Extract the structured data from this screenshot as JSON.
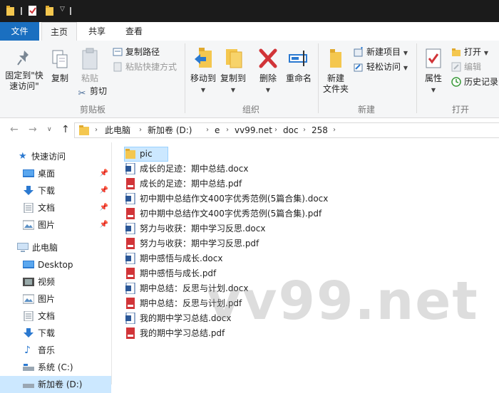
{
  "ribbon": {
    "tabs": [
      "文件",
      "主页",
      "共享",
      "查看"
    ],
    "clipboard": {
      "pin_label": "固定到\"快\n速访问\"",
      "pin_line1": "固定到\"快",
      "pin_line2": "速访问\"",
      "copy": "复制",
      "paste": "粘贴",
      "copy_path": "复制路径",
      "paste_shortcut": "粘贴快捷方式",
      "cut": "剪切",
      "group": "剪贴板"
    },
    "organize": {
      "move_to": "移动到",
      "copy_to": "复制到",
      "delete": "删除",
      "rename": "重命名",
      "group": "组织"
    },
    "new": {
      "new_folder_line1": "新建",
      "new_folder_line2": "文件夹",
      "new_item": "新建项目",
      "easy_access": "轻松访问",
      "group": "新建"
    },
    "open": {
      "properties": "属性",
      "open": "打开",
      "edit": "编辑",
      "history": "历史记录",
      "group": "打开"
    }
  },
  "address": {
    "crumbs": [
      "此电脑",
      "新加卷 (D:)",
      "e",
      "vv99.net",
      "doc",
      "258"
    ]
  },
  "sidebar": {
    "quick_access": "快速访问",
    "quick_items": [
      "桌面",
      "下载",
      "文档",
      "图片"
    ],
    "this_pc": "此电脑",
    "pc_items": [
      "Desktop",
      "视频",
      "图片",
      "文档",
      "下载",
      "音乐",
      "系统 (C:)",
      "新加卷 (D:)"
    ]
  },
  "files": [
    {
      "name": "pic",
      "type": "folder"
    },
    {
      "name": "成长的足迹：期中总结.docx",
      "type": "docx"
    },
    {
      "name": "成长的足迹：期中总结.pdf",
      "type": "pdf"
    },
    {
      "name": "初中期中总结作文400字优秀范例(5篇合集).docx",
      "type": "docx"
    },
    {
      "name": "初中期中总结作文400字优秀范例(5篇合集).pdf",
      "type": "pdf"
    },
    {
      "name": "努力与收获：期中学习反思.docx",
      "type": "docx"
    },
    {
      "name": "努力与收获：期中学习反思.pdf",
      "type": "pdf"
    },
    {
      "name": "期中感悟与成长.docx",
      "type": "docx"
    },
    {
      "name": "期中感悟与成长.pdf",
      "type": "pdf"
    },
    {
      "name": "期中总结：反思与计划.docx",
      "type": "docx"
    },
    {
      "name": "期中总结：反思与计划.pdf",
      "type": "pdf"
    },
    {
      "name": "我的期中学习总结.docx",
      "type": "docx"
    },
    {
      "name": "我的期中学习总结.pdf",
      "type": "pdf"
    }
  ],
  "watermark": "vv99.net",
  "colors": {
    "accent": "#1a6fc0",
    "selection": "#cce8ff",
    "folder": "#f4c74f",
    "word": "#2b5797",
    "pdf": "#d13438",
    "titlebar": "#1b1b1b"
  }
}
